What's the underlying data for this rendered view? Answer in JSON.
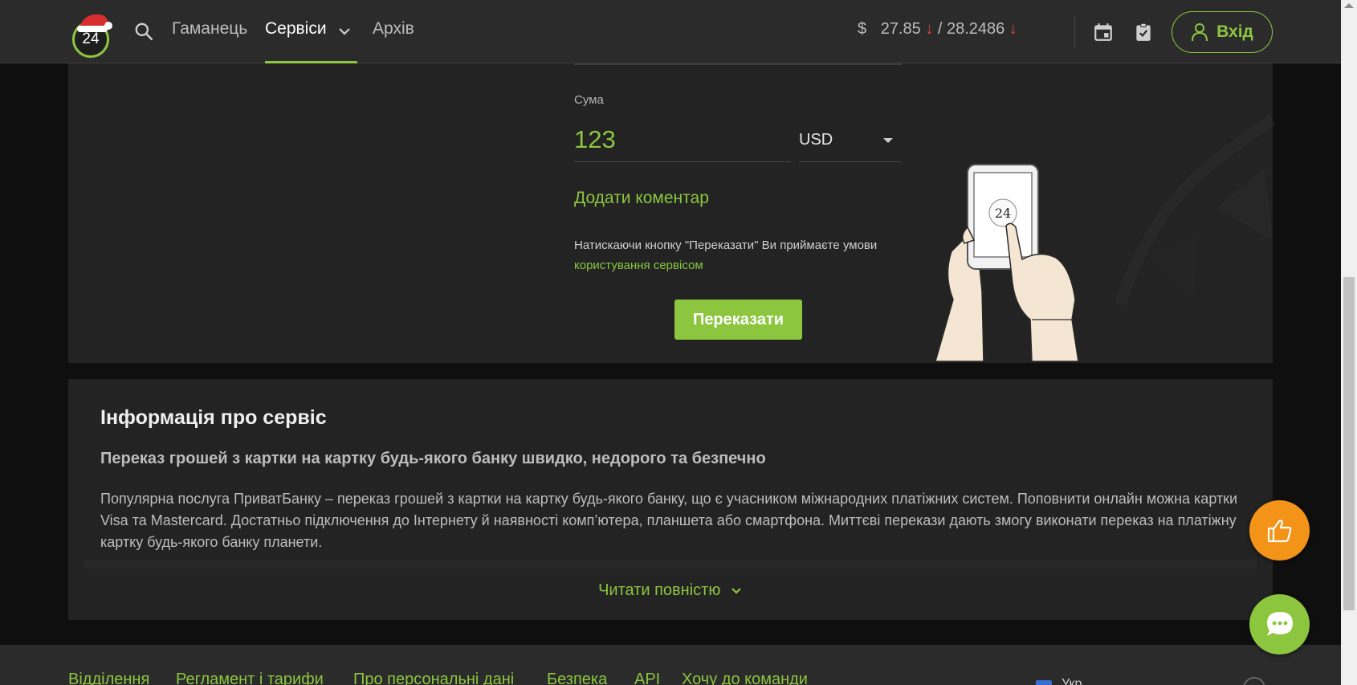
{
  "header": {
    "logo_text": "24",
    "nav": [
      {
        "label": "Гаманець"
      },
      {
        "label": "Сервіси"
      },
      {
        "label": "Архів"
      }
    ],
    "rates": {
      "currency_symbol": "$",
      "buy": "27.85",
      "sell": "/ 28.2486",
      "trend_buy": "↓",
      "trend_sell": "↓"
    },
    "login_label": "Вхід"
  },
  "form": {
    "sum_label": "Сума",
    "sum_value": "123",
    "currency": "USD",
    "add_comment": "Додати коментар",
    "terms_text": "Натискаючи кнопку \"Переказати\" Ви приймаєте умови",
    "terms_link": "користування сервісом",
    "submit_label": "Переказати",
    "illustration_badge": "24"
  },
  "info": {
    "title": "Інформація про сервіс",
    "subtitle": "Переказ грошей з картки на картку будь-якого банку швидко, недорого та безпечно",
    "text": "Популярна послуга ПриватБанку – переказ грошей з картки на картку будь-якого банку, що є учасником міжнародних платіжних систем. Поповнити онлайн можна картки Visa та Mastercard. Достатньо підключення до Інтернету й наявності комп’ютера, планшета або смартфона. Миттєві перекази дають змогу виконати переказ на платіжну картку будь-якого банку планети.",
    "read_more": "Читати повністю"
  },
  "footer": {
    "links": [
      {
        "label": "Відділення"
      },
      {
        "label": "Регламент і тарифи"
      },
      {
        "label": "Про персональні дані"
      },
      {
        "label": "Безпека"
      },
      {
        "label": "API"
      },
      {
        "label": "Хочу до команди"
      }
    ],
    "checkbox_label": "Укр"
  },
  "colors": {
    "accent": "#8cc63f",
    "rate_down": "#e0463a",
    "like_button": "#f39418",
    "header_bg": "#2b2b2b",
    "panel_bg": "#232323"
  },
  "icons": {
    "search": "search-icon",
    "calendar": "calendar-icon",
    "clipboard": "clipboard-check-icon",
    "user": "user-icon",
    "like": "thumbs-up-icon",
    "chat": "chat-bubble-icon"
  }
}
